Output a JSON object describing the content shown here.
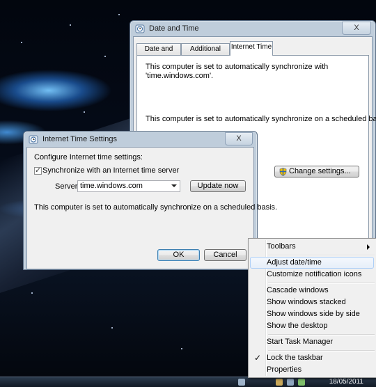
{
  "date_time_window": {
    "title": "Date and Time",
    "close_label": "X",
    "tabs": [
      {
        "label": "Date and Time"
      },
      {
        "label": "Additional Clocks"
      },
      {
        "label": "Internet Time"
      }
    ],
    "sync_text_1": "This computer is set to automatically synchronize with",
    "sync_text_2": "'time.windows.com'.",
    "schedule_text": "This computer is set to automatically synchronize on a scheduled basis.",
    "change_settings_label": "Change settings..."
  },
  "internet_time_dialog": {
    "title": "Internet Time Settings",
    "close_label": "X",
    "configure_label": "Configure Internet time settings:",
    "sync_checkbox_label": "Synchronize with an Internet time server",
    "sync_checked": true,
    "server_label": "Server:",
    "server_value": "time.windows.com",
    "update_now_label": "Update now",
    "schedule_text": "This computer is set to automatically synchronize on a scheduled basis.",
    "ok_label": "OK",
    "cancel_label": "Cancel"
  },
  "context_menu": {
    "items": [
      {
        "label": "Toolbars"
      },
      {
        "label": "Adjust date/time"
      },
      {
        "label": "Customize notification icons"
      },
      {
        "label": "Cascade windows"
      },
      {
        "label": "Show windows stacked"
      },
      {
        "label": "Show windows side by side"
      },
      {
        "label": "Show the desktop"
      },
      {
        "label": "Start Task Manager"
      },
      {
        "label": "Lock the taskbar"
      },
      {
        "label": "Properties"
      }
    ],
    "check_mark": "✓"
  },
  "taskbar": {
    "clock_date": "18/05/2011"
  },
  "colors": {
    "accent_border": "#3c7fb1",
    "menu_highlight": "#aecff7",
    "taskbar": "#121a25"
  }
}
